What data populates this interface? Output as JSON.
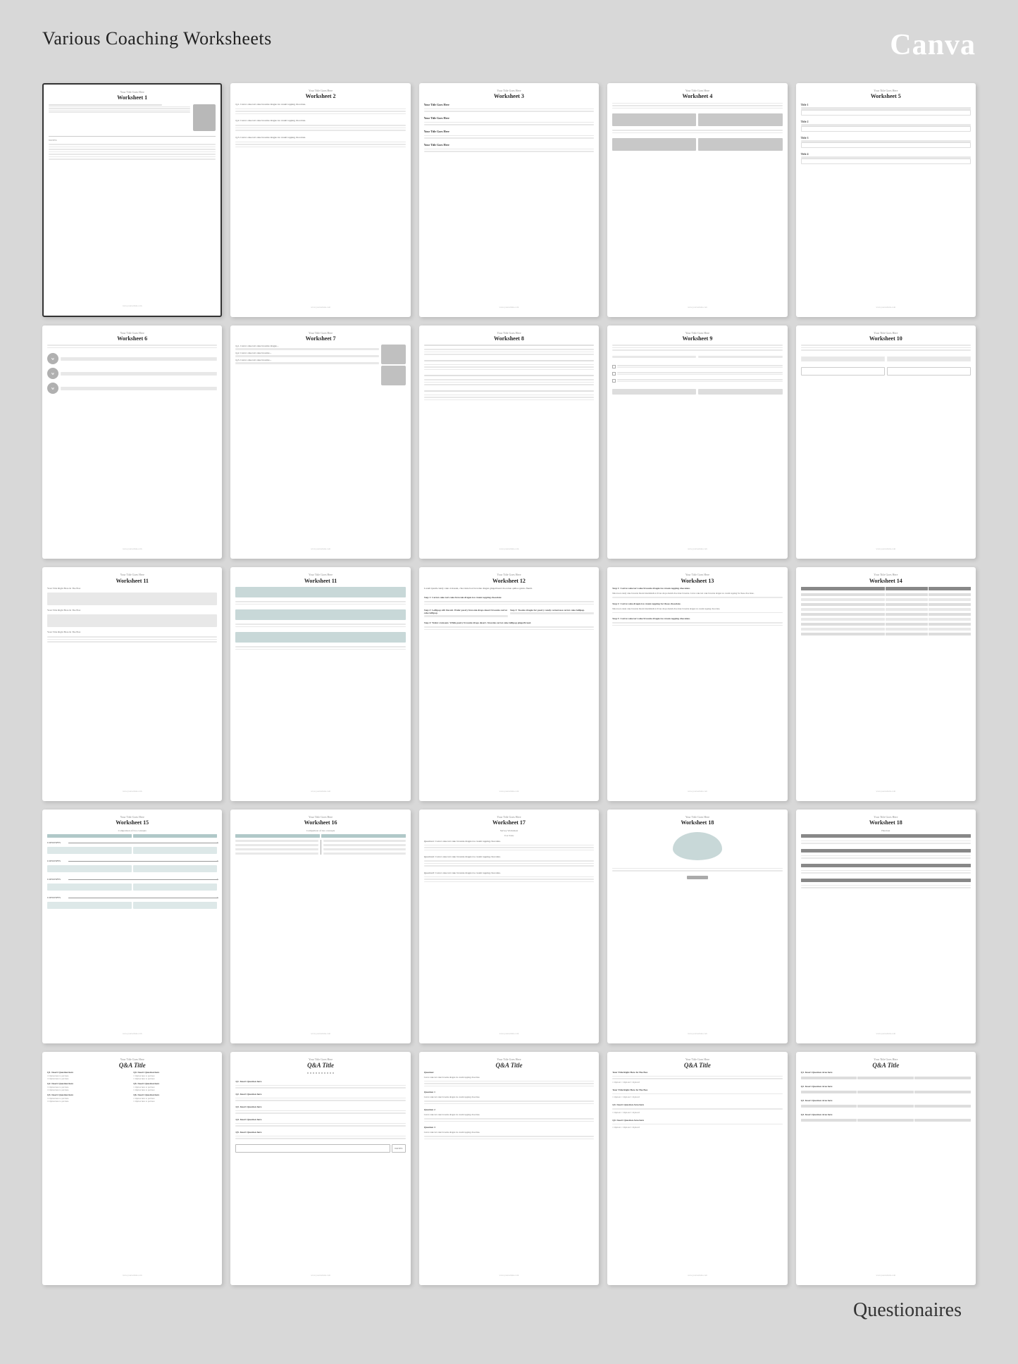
{
  "header": {
    "title": "Various Coaching Worksheets",
    "logo": "Canva"
  },
  "worksheets": [
    {
      "id": 1,
      "title": "Worksheet 1",
      "subtitle": "Your Title Goes Here",
      "type": "image-text"
    },
    {
      "id": 2,
      "title": "Worksheet 2",
      "subtitle": "Your Title Goes Here",
      "type": "lines"
    },
    {
      "id": 3,
      "title": "Worksheet 3",
      "subtitle": "Your Title Goes Here",
      "type": "qa-lines"
    },
    {
      "id": 4,
      "title": "Worksheet 4",
      "subtitle": "Your Title Goes Here",
      "type": "two-col-lines"
    },
    {
      "id": 5,
      "title": "Worksheet 5",
      "subtitle": "Your Title Goes Here",
      "type": "labeled-lines"
    },
    {
      "id": 6,
      "title": "Worksheet 6",
      "subtitle": "Your Title Goes Here",
      "type": "circles"
    },
    {
      "id": 7,
      "title": "Worksheet 7",
      "subtitle": "Your Title Goes Here",
      "type": "image-text"
    },
    {
      "id": 8,
      "title": "Worksheet 8",
      "subtitle": "Your Title Goes Here",
      "type": "lines"
    },
    {
      "id": 9,
      "title": "Worksheet 9",
      "subtitle": "Your Title Goes Here",
      "type": "checkbox"
    },
    {
      "id": 10,
      "title": "Worksheet 10",
      "subtitle": "Your Title Goes Here",
      "type": "two-col"
    },
    {
      "id": 11,
      "title": "Worksheet 11",
      "subtitle": "Your Title Goes Here",
      "type": "sections"
    },
    {
      "id": 12,
      "title": "Worksheet 11",
      "subtitle": "Your Title Goes Here",
      "type": "blocks"
    },
    {
      "id": 13,
      "title": "Worksheet 12",
      "subtitle": "Your Title Goes Here",
      "type": "steps"
    },
    {
      "id": 14,
      "title": "Worksheet 13",
      "subtitle": "Your Title Goes Here",
      "type": "steps2"
    },
    {
      "id": 15,
      "title": "Worksheet 14",
      "subtitle": "Your Title Goes Here",
      "type": "table"
    },
    {
      "id": 16,
      "title": "Worksheet 15",
      "subtitle": "Your Title Goes Here",
      "type": "comparison"
    },
    {
      "id": 17,
      "title": "Worksheet 16",
      "subtitle": "Your Title Goes Here",
      "type": "two-col-v"
    },
    {
      "id": 18,
      "title": "Worksheet 17",
      "subtitle": "Your Title Goes Here",
      "type": "survey"
    },
    {
      "id": 19,
      "title": "Worksheet 18",
      "subtitle": "Your Title Goes Here",
      "type": "cloud"
    },
    {
      "id": 20,
      "title": "Worksheet 18",
      "subtitle": "Your Title Goes Here",
      "type": "table2"
    },
    {
      "id": 21,
      "title": "Q&A Title",
      "subtitle": "Your Title Goes Here",
      "type": "qa-two"
    },
    {
      "id": 22,
      "title": "Q&A Title",
      "subtitle": "Your Title Goes Here",
      "type": "qa-dots"
    },
    {
      "id": 23,
      "title": "Q&A Title",
      "subtitle": "Your Title Goes Here",
      "type": "qa-lines2"
    },
    {
      "id": 24,
      "title": "Q&A Title",
      "subtitle": "Your Title Goes Here",
      "type": "qa-col"
    },
    {
      "id": 25,
      "title": "Q&A Title",
      "subtitle": "Your Title Goes Here",
      "type": "qa-table"
    }
  ],
  "footnote": "Questionaires"
}
